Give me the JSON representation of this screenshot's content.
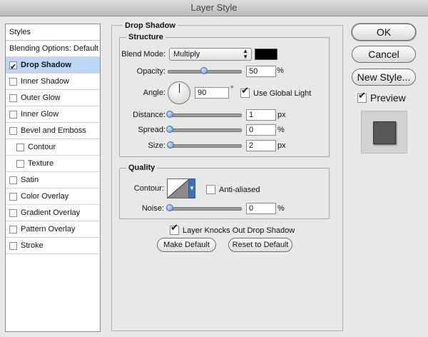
{
  "window": {
    "title": "Layer Style"
  },
  "styles_list": {
    "header": "Styles",
    "items": [
      {
        "label": "Blending Options: Default",
        "checkbox": false,
        "checked": false,
        "selected": false,
        "sub": false
      },
      {
        "label": "Drop Shadow",
        "checkbox": true,
        "checked": true,
        "selected": true,
        "sub": false
      },
      {
        "label": "Inner Shadow",
        "checkbox": true,
        "checked": false,
        "selected": false,
        "sub": false
      },
      {
        "label": "Outer Glow",
        "checkbox": true,
        "checked": false,
        "selected": false,
        "sub": false
      },
      {
        "label": "Inner Glow",
        "checkbox": true,
        "checked": false,
        "selected": false,
        "sub": false
      },
      {
        "label": "Bevel and Emboss",
        "checkbox": true,
        "checked": false,
        "selected": false,
        "sub": false
      },
      {
        "label": "Contour",
        "checkbox": true,
        "checked": false,
        "selected": false,
        "sub": true
      },
      {
        "label": "Texture",
        "checkbox": true,
        "checked": false,
        "selected": false,
        "sub": true
      },
      {
        "label": "Satin",
        "checkbox": true,
        "checked": false,
        "selected": false,
        "sub": false
      },
      {
        "label": "Color Overlay",
        "checkbox": true,
        "checked": false,
        "selected": false,
        "sub": false
      },
      {
        "label": "Gradient Overlay",
        "checkbox": true,
        "checked": false,
        "selected": false,
        "sub": false
      },
      {
        "label": "Pattern Overlay",
        "checkbox": true,
        "checked": false,
        "selected": false,
        "sub": false
      },
      {
        "label": "Stroke",
        "checkbox": true,
        "checked": false,
        "selected": false,
        "sub": false
      }
    ]
  },
  "drop_shadow": {
    "title": "Drop Shadow",
    "structure": {
      "title": "Structure",
      "blend_mode_label": "Blend Mode:",
      "blend_mode_value": "Multiply",
      "shadow_color": "#000000",
      "opacity_label": "Opacity:",
      "opacity_value": "50",
      "opacity_unit": "%",
      "opacity_level": 0.5,
      "angle_label": "Angle:",
      "angle_value": "90",
      "angle_unit": "°",
      "use_global_light_label": "Use Global Light",
      "use_global_light_checked": true,
      "distance_label": "Distance:",
      "distance_value": "1",
      "distance_unit": "px",
      "spread_label": "Spread:",
      "spread_value": "0",
      "spread_unit": "%",
      "size_label": "Size:",
      "size_value": "2",
      "size_unit": "px"
    },
    "quality": {
      "title": "Quality",
      "contour_label": "Contour:",
      "anti_aliased_label": "Anti-aliased",
      "anti_aliased_checked": false,
      "noise_label": "Noise:",
      "noise_value": "0",
      "noise_unit": "%"
    },
    "knocks_out_label": "Layer Knocks Out Drop Shadow",
    "knocks_out_checked": true,
    "make_default_label": "Make Default",
    "reset_default_label": "Reset to Default"
  },
  "buttons": {
    "ok": "OK",
    "cancel": "Cancel",
    "new_style": "New Style...",
    "preview_label": "Preview",
    "preview_checked": true
  },
  "colors": {
    "selected_row": "#bcd7f5",
    "preview_swatch": "#575757"
  }
}
